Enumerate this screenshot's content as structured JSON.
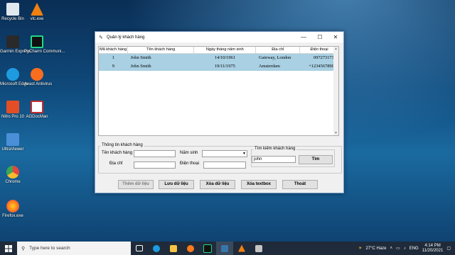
{
  "desktop": {
    "icons": [
      {
        "label": "Recycle Bin",
        "icon": "recycle-bin-icon",
        "color": "#dfe7ef"
      },
      {
        "label": "vlc.exe",
        "icon": "vlc-icon",
        "color": "#f08010"
      },
      {
        "label": "Garmin Express",
        "icon": "garmin-icon",
        "color": "#2a2a2a"
      },
      {
        "label": "PyCharm Communi...",
        "icon": "pycharm-icon",
        "color": "#21d789"
      },
      {
        "label": "Microsoft Edge",
        "icon": "edge-icon",
        "color": "#1e9be0"
      },
      {
        "label": "Avast Antivirus",
        "icon": "avast-icon",
        "color": "#f96d1e"
      },
      {
        "label": "Nitro Pro 10",
        "icon": "nitro-icon",
        "color": "#e34e26"
      },
      {
        "label": "AGDocMan",
        "icon": "agdocman-icon",
        "color": "#c52e2e"
      },
      {
        "label": "UltraViewer",
        "icon": "ultraviewer-icon",
        "color": "#4a8fd8"
      },
      {
        "label": "Chrome",
        "icon": "chrome-icon",
        "color": "#e8453c"
      },
      {
        "label": "Firefox.exe",
        "icon": "firefox-icon",
        "color": "#ff7a1a"
      }
    ]
  },
  "window": {
    "title": "Quản lý khách hàng",
    "controls": {
      "minimize": "—",
      "maximize": "☐",
      "close": "✕"
    }
  },
  "table": {
    "headers": [
      "Mã khách hàng",
      "Tên khách hàng",
      "Ngày tháng năm sinh",
      "Địa chỉ",
      "Điện thoại"
    ],
    "rows": [
      [
        "1",
        "John Smith",
        "14/10/1961",
        "Gateway, London",
        "0972731732"
      ],
      [
        "9",
        "John Smith",
        "19/11/1975",
        "Amsterdam",
        "+12345678901"
      ]
    ]
  },
  "form": {
    "group_title": "Thông tin khách hàng",
    "name_label": "Tên khách hàng",
    "name_value": "",
    "address_label": "Địa chỉ",
    "address_value": "",
    "birthyear_label": "Năm sinh",
    "birthyear_value": "",
    "phone_label": "Điện thoại",
    "phone_value": "",
    "search_group_title": "Tìm kiếm khách hàng",
    "search_value": "john",
    "search_button": "Tìm"
  },
  "buttons": {
    "add": "Thêm dữ liệu",
    "save": "Lưu dữ liệu",
    "delete": "Xóa dữ liệu",
    "clear": "Xóa textbox",
    "exit": "Thoát"
  },
  "taskbar": {
    "search_placeholder": "Type here to search",
    "weather": "27°C  Haze",
    "language": "ENG",
    "time": "4:14 PM",
    "date": "11/20/2021"
  }
}
